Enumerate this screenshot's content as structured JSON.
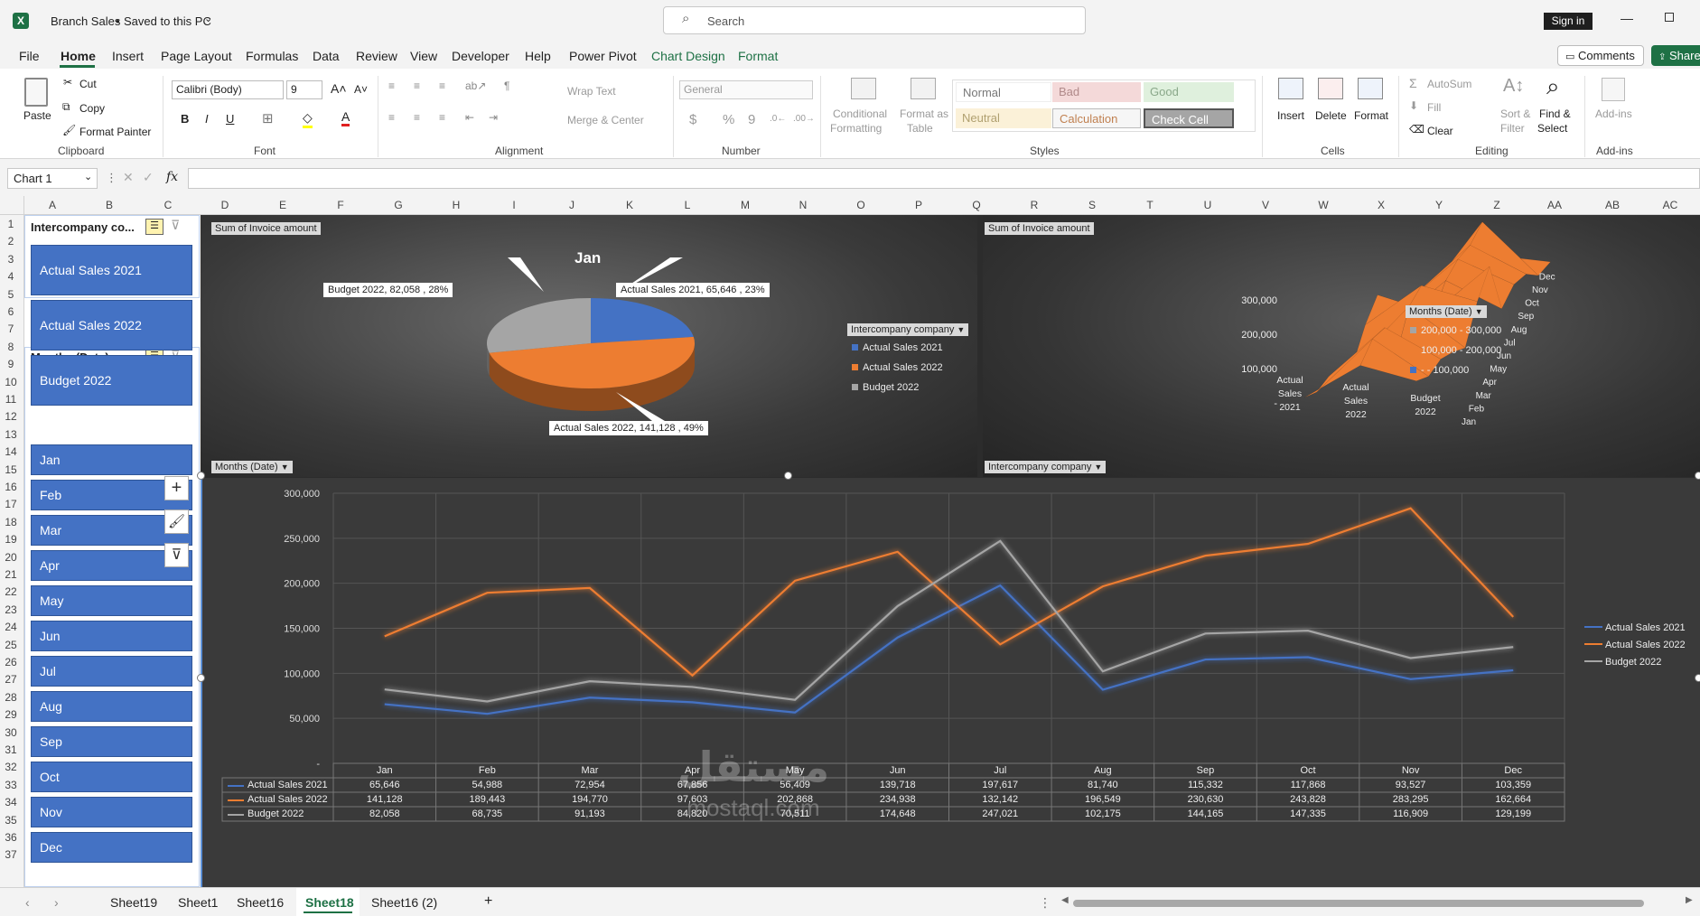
{
  "title_bar": {
    "file_name": "Branch Sales",
    "save_status": "Saved to this PC",
    "search_placeholder": "Search",
    "sign_in": "Sign in",
    "excel_glyph": "X"
  },
  "menu": {
    "tabs": [
      "File",
      "Home",
      "Insert",
      "Page Layout",
      "Formulas",
      "Data",
      "Review",
      "View",
      "Developer",
      "Help",
      "Power Pivot",
      "Chart Design",
      "Format"
    ],
    "active": "Home",
    "comments": "Comments",
    "share": "Share",
    "accent": "#1e7145"
  },
  "ribbon": {
    "clipboard": {
      "paste": "Paste",
      "cut": "Cut",
      "copy": "Copy",
      "format_painter": "Format Painter",
      "label": "Clipboard"
    },
    "font": {
      "name": "Calibri (Body)",
      "size": "9",
      "label": "Font",
      "bold": "B",
      "italic": "I",
      "underline": "U"
    },
    "alignment": {
      "wrap_text": "Wrap Text",
      "merge_center": "Merge & Center",
      "label": "Alignment"
    },
    "number": {
      "format": "General",
      "currency": "$",
      "percent": "%",
      "comma": "9",
      "label": "Number"
    },
    "styles": {
      "conditional": "Conditional",
      "formatting": "Formatting",
      "format_as": "Format as",
      "table": "Table",
      "normal": "Normal",
      "bad": "Bad",
      "good": "Good",
      "neutral": "Neutral",
      "calculation": "Calculation",
      "check_cell": "Check Cell",
      "label": "Styles"
    },
    "cells": {
      "insert": "Insert",
      "delete": "Delete",
      "format": "Format",
      "label": "Cells"
    },
    "editing": {
      "autosum": "AutoSum",
      "fill": "Fill",
      "clear": "Clear",
      "sort": "Sort &",
      "filter": "Filter",
      "find": "Find &",
      "select": "Select",
      "label": "Editing"
    },
    "addins": {
      "label": "Add-ins",
      "btn": "Add-ins"
    }
  },
  "formula_bar": {
    "name_box": "Chart 1",
    "fx": "fx",
    "value": ""
  },
  "columns": [
    "A",
    "B",
    "C",
    "D",
    "E",
    "F",
    "G",
    "H",
    "I",
    "J",
    "K",
    "L",
    "M",
    "N",
    "O",
    "P",
    "Q",
    "R",
    "S",
    "T",
    "U",
    "V",
    "W",
    "X",
    "Y",
    "Z",
    "AA",
    "AB",
    "AC"
  ],
  "rows": [
    "1",
    "2",
    "3",
    "4",
    "5",
    "6",
    "7",
    "8",
    "9",
    "10",
    "11",
    "12",
    "13",
    "14",
    "15",
    "16",
    "17",
    "18",
    "19",
    "20",
    "21",
    "22",
    "23",
    "24",
    "25",
    "26",
    "27",
    "28",
    "29",
    "30",
    "31",
    "32",
    "33",
    "34",
    "35",
    "36",
    "37"
  ],
  "slicers": {
    "company": {
      "title": "Intercompany co...",
      "items": [
        "Actual Sales 2021",
        "Actual Sales 2022",
        "Budget 2022"
      ]
    },
    "months": {
      "title": "Months (Date)",
      "items": [
        "Jan",
        "Feb",
        "Mar",
        "Apr",
        "May",
        "Jun",
        "Jul",
        "Aug",
        "Sep",
        "Oct",
        "Nov",
        "Dec"
      ]
    }
  },
  "pie_chart": {
    "field_tag": "Sum of Invoice amount",
    "axis_tag": "Months (Date)",
    "title": "Jan",
    "legend_tag": "Intercompany company",
    "chart_data": {
      "type": "pie",
      "title": "Jan",
      "categories": [
        "Actual Sales 2021",
        "Actual Sales 2022",
        "Budget 2022"
      ],
      "values": [
        65646,
        141128,
        82058
      ],
      "percents": [
        23,
        49,
        28
      ],
      "colors": [
        "#4472c4",
        "#ed7d31",
        "#a5a5a5"
      ]
    },
    "labels": [
      "Actual Sales 2021,  65,646 , 23%",
      "Actual Sales 2022,  141,128 , 49%",
      "Budget 2022,  82,058 , 28%"
    ]
  },
  "surface_chart": {
    "field_tag": "Sum of Invoice amount",
    "axis_tag": "Intercompany company",
    "legend_tag": "Months (Date)",
    "y_ticks": [
      "300,000",
      "200,000",
      "100,000",
      "-"
    ],
    "series_labels": [
      [
        "Actual",
        "Sales",
        "2021"
      ],
      [
        "Actual",
        "Sales",
        "2022"
      ],
      [
        "Budget",
        "2022"
      ]
    ],
    "month_labels": [
      "Jan",
      "Feb",
      "Mar",
      "Apr",
      "May",
      "Jun",
      "Jul",
      "Aug",
      "Sep",
      "Oct",
      "Nov",
      "Dec"
    ],
    "legend": [
      {
        "label": "200,000 - 300,000",
        "color": "#a5a5a5"
      },
      {
        "label": "100,000 - 200,000",
        "color": "#ed7d31"
      },
      {
        "label": "-  - 100,000",
        "color": "#4472c4"
      }
    ],
    "chart_data": {
      "type": "surface",
      "categories": [
        "Jan",
        "Feb",
        "Mar",
        "Apr",
        "May",
        "Jun",
        "Jul",
        "Aug",
        "Sep",
        "Oct",
        "Nov",
        "Dec"
      ],
      "series": [
        {
          "name": "Actual Sales 2021",
          "values": [
            65646,
            54988,
            72954,
            67856,
            56409,
            139718,
            197617,
            81740,
            115332,
            117868,
            93527,
            103359
          ]
        },
        {
          "name": "Actual Sales 2022",
          "values": [
            141128,
            189443,
            194770,
            97603,
            202868,
            234938,
            132142,
            196549,
            230630,
            243828,
            283295,
            162664
          ]
        },
        {
          "name": "Budget 2022",
          "values": [
            82058,
            68735,
            91193,
            84820,
            70511,
            174648,
            247021,
            102175,
            144165,
            147335,
            116909,
            129199
          ]
        }
      ],
      "ylim": [
        0,
        300000
      ]
    }
  },
  "line_chart": {
    "y_tick_labels": [
      "300,000",
      "250,000",
      "200,000",
      "150,000",
      "100,000",
      "50,000",
      "-"
    ],
    "chart_data": {
      "type": "line",
      "categories": [
        "Jan",
        "Feb",
        "Mar",
        "Apr",
        "May",
        "Jun",
        "Jul",
        "Aug",
        "Sep",
        "Oct",
        "Nov",
        "Dec"
      ],
      "ylim": [
        0,
        300000
      ],
      "y_ticks": [
        0,
        50000,
        100000,
        150000,
        200000,
        250000,
        300000
      ],
      "grid": true,
      "legend_position": "right",
      "series": [
        {
          "name": "Actual Sales 2021",
          "color": "#4472c4",
          "values": [
            65646,
            54988,
            72954,
            67856,
            56409,
            139718,
            197617,
            81740,
            115332,
            117868,
            93527,
            103359
          ]
        },
        {
          "name": "Actual Sales 2022",
          "color": "#ed7d31",
          "values": [
            141128,
            189443,
            194770,
            97603,
            202868,
            234938,
            132142,
            196549,
            230630,
            243828,
            283295,
            162664
          ]
        },
        {
          "name": "Budget 2022",
          "color": "#a5a5a5",
          "values": [
            82058,
            68735,
            91193,
            84820,
            70511,
            174648,
            247021,
            102175,
            144165,
            147335,
            116909,
            129199
          ]
        }
      ]
    },
    "table_rows": [
      [
        "65,646",
        "54,988",
        "72,954",
        "67,856",
        "56,409",
        "139,718",
        "197,617",
        "81,740",
        "115,332",
        "117,868",
        "93,527",
        "103,359"
      ],
      [
        "141,128",
        "189,443",
        "194,770",
        "97,603",
        "202,868",
        "234,938",
        "132,142",
        "196,549",
        "230,630",
        "243,828",
        "283,295",
        "162,664"
      ],
      [
        "82,058",
        "68,735",
        "91,193",
        "84,820",
        "70,511",
        "174,648",
        "247,021",
        "102,175",
        "144,165",
        "147,335",
        "116,909",
        "129,199"
      ]
    ]
  },
  "watermark": {
    "arabic": "مستقل",
    "latin": "mostaql.com"
  },
  "sheet_tabs": {
    "tabs": [
      "Sheet19",
      "Sheet1",
      "Sheet16",
      "Sheet18",
      "Sheet16 (2)"
    ],
    "active": "Sheet18",
    "add": "+"
  }
}
